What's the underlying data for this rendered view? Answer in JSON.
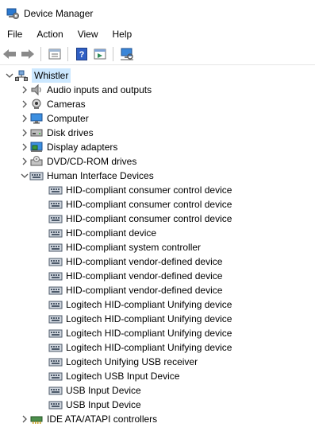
{
  "window": {
    "title": "Device Manager",
    "icon": "device-manager-icon"
  },
  "menu": [
    "File",
    "Action",
    "View",
    "Help"
  ],
  "toolbar": {
    "buttons": [
      "back-arrow-icon",
      "forward-arrow-icon",
      "properties-icon",
      "help-icon",
      "show-hidden-icon",
      "scan-hardware-icon"
    ]
  },
  "tree": {
    "root": {
      "label": "Whistler",
      "icon": "computer-root-icon",
      "expanded": true
    },
    "categories": [
      {
        "label": "Audio inputs and outputs",
        "icon": "speaker-icon",
        "expanded": false
      },
      {
        "label": "Cameras",
        "icon": "camera-icon",
        "expanded": false
      },
      {
        "label": "Computer",
        "icon": "monitor-icon",
        "expanded": false
      },
      {
        "label": "Disk drives",
        "icon": "disk-drive-icon",
        "expanded": false
      },
      {
        "label": "Display adapters",
        "icon": "display-adapter-icon",
        "expanded": false
      },
      {
        "label": "DVD/CD-ROM drives",
        "icon": "dvd-icon",
        "expanded": false
      },
      {
        "label": "Human Interface Devices",
        "icon": "hid-icon",
        "expanded": true
      }
    ],
    "hid_devices": [
      "HID-compliant consumer control device",
      "HID-compliant consumer control device",
      "HID-compliant consumer control device",
      "HID-compliant device",
      "HID-compliant system controller",
      "HID-compliant vendor-defined device",
      "HID-compliant vendor-defined device",
      "HID-compliant vendor-defined device",
      "Logitech HID-compliant Unifying device",
      "Logitech HID-compliant Unifying device",
      "Logitech HID-compliant Unifying device",
      "Logitech HID-compliant Unifying device",
      "Logitech Unifying USB receiver",
      "Logitech USB Input Device",
      "USB Input Device",
      "USB Input Device"
    ],
    "after": [
      {
        "label": "IDE ATA/ATAPI controllers",
        "icon": "ide-controller-icon",
        "expanded": false
      }
    ]
  },
  "colors": {
    "selection": "#cce8ff",
    "separator": "#e5e5e5"
  }
}
